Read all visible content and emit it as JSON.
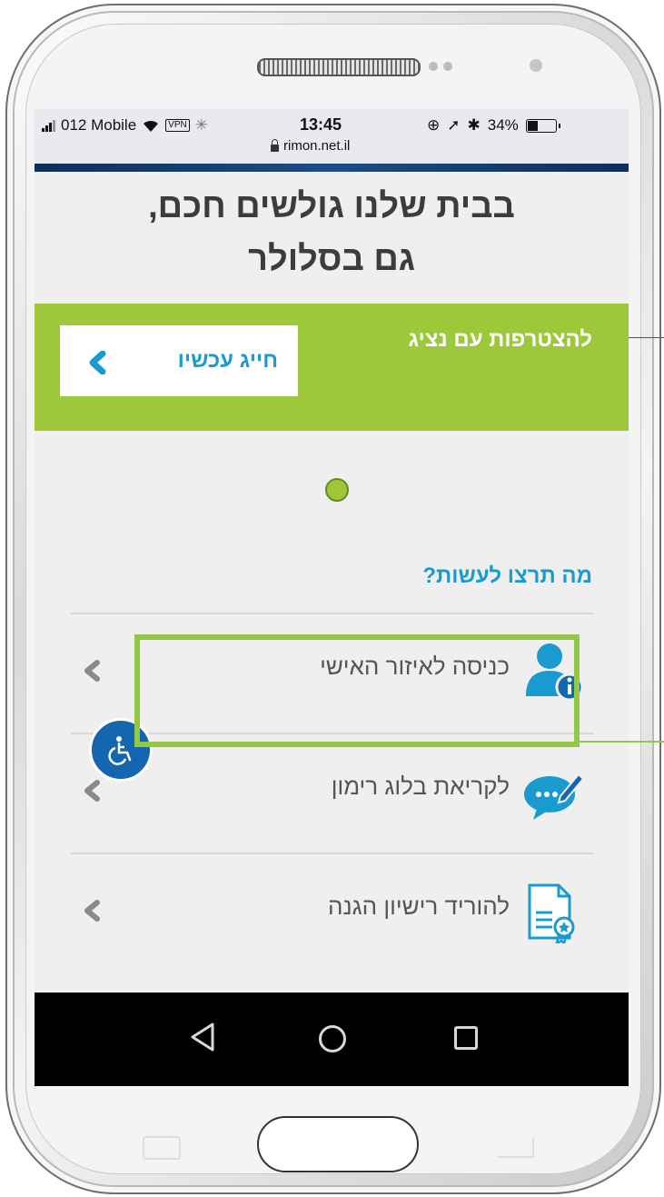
{
  "status_bar": {
    "carrier": "012 Mobile",
    "vpn": "VPN",
    "time": "13:45",
    "url": "rimon.net.il",
    "battery": "34%",
    "battery_fraction": 0.34
  },
  "headline": {
    "line1": "בבית שלנו גולשים חכם,",
    "line2": "גם בסלולר"
  },
  "promo": {
    "text": "להצטרפות עם נציג",
    "button_label": "חייג עכשיו"
  },
  "section_title": "מה תרצו לעשות?",
  "menu": {
    "items": [
      {
        "label": "כניסה לאיזור האישי",
        "icon": "user-info-icon"
      },
      {
        "label": "לקריאת בלוג רימון",
        "icon": "chat-bubble-pen-icon"
      },
      {
        "label": "להוריד רישיון הגנה",
        "icon": "license-document-icon"
      }
    ]
  },
  "colors": {
    "accent_green": "#9dc83a",
    "accent_blue": "#1a9bd0",
    "highlight_green": "#92c846",
    "accessibility_blue": "#1566b1"
  }
}
